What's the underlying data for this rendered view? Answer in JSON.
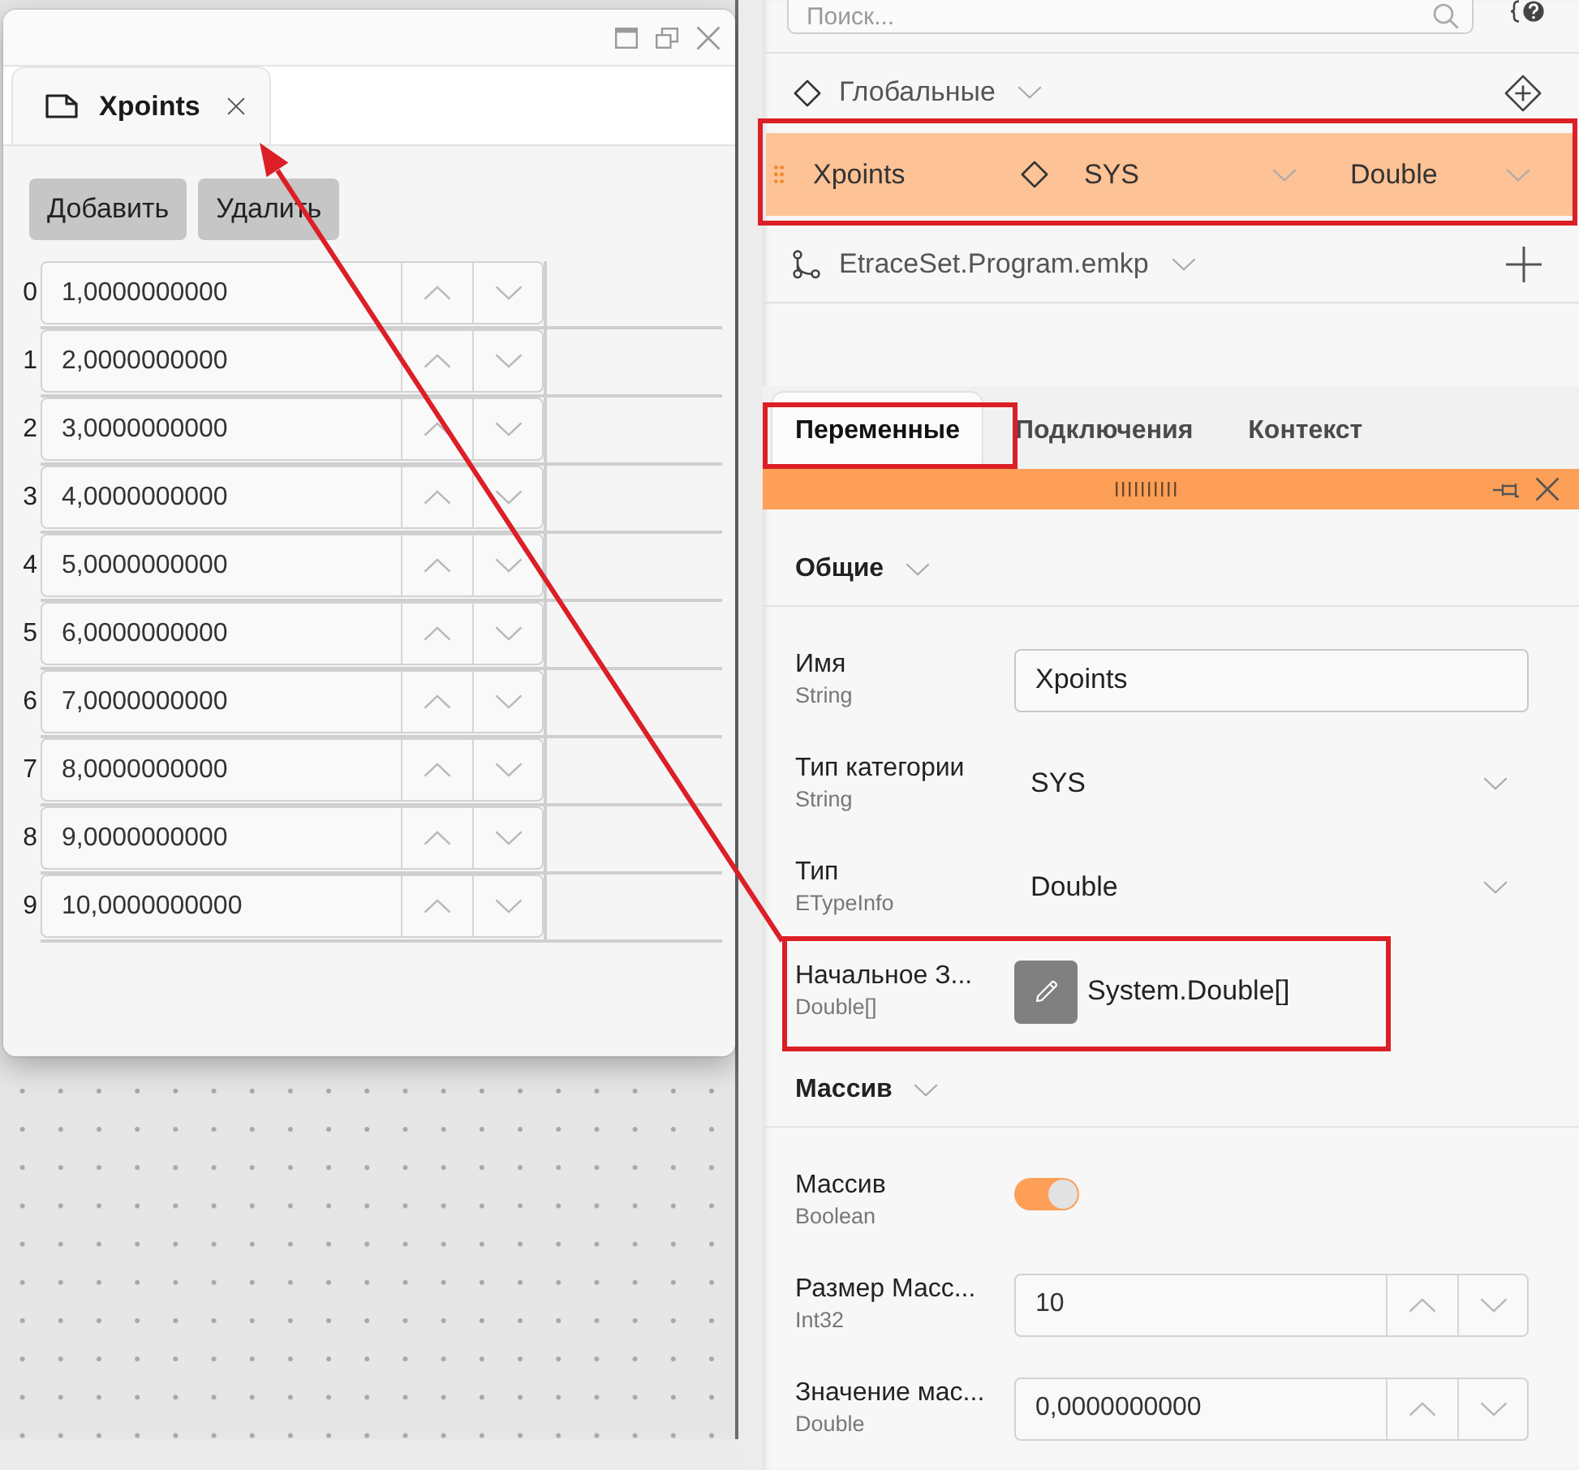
{
  "popup": {
    "tabs": [
      {
        "label": "Xpoints",
        "selected": true
      }
    ],
    "buttons": [
      "Добавить",
      "Удалить"
    ],
    "items": [
      {
        "index": "0",
        "value": "1,0000000000"
      },
      {
        "index": "1",
        "value": "2,0000000000"
      },
      {
        "index": "2",
        "value": "3,0000000000"
      },
      {
        "index": "3",
        "value": "4,0000000000"
      },
      {
        "index": "4",
        "value": "5,0000000000"
      },
      {
        "index": "5",
        "value": "6,0000000000"
      },
      {
        "index": "6",
        "value": "7,0000000000"
      },
      {
        "index": "7",
        "value": "8,0000000000"
      },
      {
        "index": "8",
        "value": "9,0000000000"
      },
      {
        "index": "9",
        "value": "10,0000000000"
      }
    ]
  },
  "explorer": {
    "search": {
      "placeholder": "Поиск..."
    },
    "items": [
      {
        "kind": "group",
        "label": "Глобальные",
        "selected": false
      },
      {
        "kind": "variable",
        "name": "Xpoints",
        "category": "SYS",
        "type": "Double",
        "selected": true
      },
      {
        "kind": "file",
        "label": "EtraceSet.Program.emkp",
        "selected": false
      }
    ]
  },
  "properties": {
    "tabs": [
      {
        "label": "Переменные",
        "selected": true
      },
      {
        "label": "Подключения",
        "selected": false
      },
      {
        "label": "Контекст",
        "selected": false
      }
    ],
    "sections": [
      {
        "title": "Общие",
        "rows": [
          {
            "kind": "text",
            "label": "Имя",
            "type": "String",
            "value": "Xpoints"
          },
          {
            "kind": "combo",
            "label": "Тип категории",
            "type": "String",
            "value": "SYS"
          },
          {
            "kind": "combo",
            "label": "Тип",
            "type": "ETypeInfo",
            "value": "Double"
          },
          {
            "kind": "editor",
            "label": "Начальное З...",
            "type": "Double[]",
            "value": "System.Double[]"
          }
        ]
      },
      {
        "title": "Массив",
        "rows": [
          {
            "kind": "toggle",
            "label": "Массив",
            "type": "Boolean",
            "on": true
          },
          {
            "kind": "spinner",
            "label": "Размер Масс...",
            "type": "Int32",
            "value": "10"
          },
          {
            "kind": "spinner",
            "label": "Значение мас...",
            "type": "Double",
            "value": "0,0000000000"
          }
        ]
      }
    ]
  }
}
